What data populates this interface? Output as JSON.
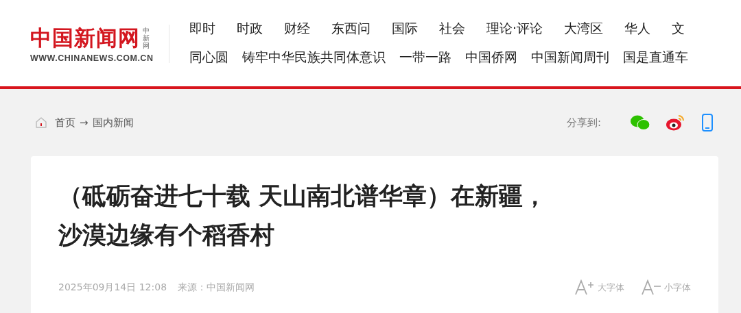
{
  "header": {
    "logo": {
      "name": "中国新闻网",
      "side": "中新网",
      "url": "WWW.CHINANEWS.COM.CN"
    },
    "nav_rows": [
      [
        "即时",
        "时政",
        "财经",
        "东西问",
        "国际",
        "社会",
        "理论·评论",
        "大湾区",
        "华人",
        "文"
      ],
      [
        "同心圆",
        "铸牢中华民族共同体意识",
        "一带一路",
        "中国侨网",
        "中国新闻周刊",
        "国是直通车"
      ]
    ]
  },
  "breadcrumb": {
    "home": "首页",
    "arrow": "→",
    "section": "国内新闻"
  },
  "share": {
    "label": "分享到:"
  },
  "article": {
    "title_lines": [
      "（砥砺奋进七十载 天山南北谱华章）在新疆，",
      "沙漠边缘有个稻香村"
    ],
    "date": "2025年09月14日 12:08",
    "source": "来源：中国新闻网",
    "font_controls": [
      {
        "kind": "larger",
        "label": "大字体"
      },
      {
        "kind": "smaller",
        "label": "小字体"
      }
    ]
  }
}
